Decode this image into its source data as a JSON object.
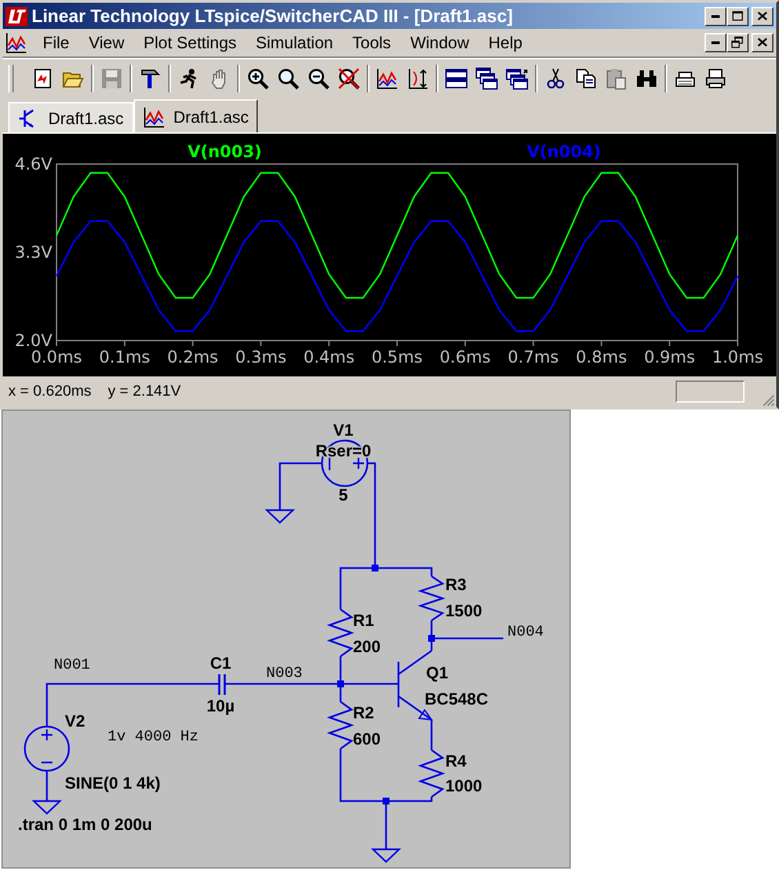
{
  "window": {
    "title": "Linear Technology LTspice/SwitcherCAD III - [Draft1.asc]"
  },
  "menu": [
    {
      "label": "File"
    },
    {
      "label": "View"
    },
    {
      "label": "Plot Settings"
    },
    {
      "label": "Simulation"
    },
    {
      "label": "Tools"
    },
    {
      "label": "Window"
    },
    {
      "label": "Help"
    }
  ],
  "toolbar": [
    [
      {
        "disabled": false
      },
      {
        "disabled": false
      }
    ],
    [
      {
        "disabled": true
      }
    ],
    [
      {
        "disabled": false
      }
    ],
    [
      {
        "disabled": false
      },
      {
        "disabled": true
      }
    ],
    [
      {
        "disabled": false
      },
      {
        "disabled": false
      },
      {
        "disabled": false
      },
      {
        "disabled": false
      }
    ],
    [
      {
        "disabled": false
      },
      {
        "disabled": false
      }
    ],
    [
      {
        "disabled": false
      },
      {
        "disabled": false
      },
      {
        "disabled": false
      }
    ],
    [
      {
        "disabled": false
      },
      {
        "disabled": false
      },
      {
        "disabled": true
      },
      {
        "disabled": false
      }
    ],
    [
      {
        "disabled": false
      },
      {
        "disabled": false
      }
    ]
  ],
  "tabs": [
    {
      "label": "Draft1.asc",
      "kind": "schematic",
      "selected": false
    },
    {
      "label": "Draft1.asc",
      "kind": "plot",
      "selected": true
    }
  ],
  "plot": {
    "chart_data": {
      "type": "line",
      "x": [
        0,
        0.025,
        0.05,
        0.075,
        0.1,
        0.125,
        0.15,
        0.175,
        0.2,
        0.225,
        0.25,
        0.275,
        0.3,
        0.325,
        0.35,
        0.375,
        0.4,
        0.425,
        0.45,
        0.475,
        0.5,
        0.525,
        0.55,
        0.575,
        0.6,
        0.625,
        0.65,
        0.675,
        0.7,
        0.725,
        0.75,
        0.775,
        0.8,
        0.825,
        0.85,
        0.875,
        0.9,
        0.925,
        0.95,
        0.975,
        1.0
      ],
      "series": [
        {
          "name": "V(n003)",
          "color": "#00ff00",
          "values": [
            3.55,
            4.12,
            4.47,
            4.47,
            4.12,
            3.55,
            2.98,
            2.63,
            2.63,
            2.98,
            3.55,
            4.12,
            4.47,
            4.47,
            4.12,
            3.55,
            2.98,
            2.63,
            2.63,
            2.98,
            3.55,
            4.12,
            4.47,
            4.47,
            4.12,
            3.55,
            2.98,
            2.63,
            2.63,
            2.98,
            3.55,
            4.12,
            4.47,
            4.47,
            4.12,
            3.55,
            2.98,
            2.63,
            2.63,
            2.98,
            3.55
          ]
        },
        {
          "name": "V(n004)",
          "color": "#0000ff",
          "values": [
            2.95,
            3.45,
            3.76,
            3.76,
            3.45,
            2.95,
            2.45,
            2.14,
            2.14,
            2.45,
            2.95,
            3.45,
            3.76,
            3.76,
            3.45,
            2.95,
            2.45,
            2.14,
            2.14,
            2.45,
            2.95,
            3.45,
            3.76,
            3.76,
            3.45,
            2.95,
            2.45,
            2.14,
            2.14,
            2.45,
            2.95,
            3.45,
            3.76,
            3.76,
            3.45,
            2.95,
            2.45,
            2.14,
            2.14,
            2.45,
            2.95
          ]
        }
      ],
      "xlim": [
        0,
        1
      ],
      "ylim": [
        2,
        4.6
      ],
      "xticks": [
        {
          "value": 0,
          "label": "0.0ms"
        },
        {
          "value": 0.1,
          "label": "0.1ms"
        },
        {
          "value": 0.2,
          "label": "0.2ms"
        },
        {
          "value": 0.3,
          "label": "0.3ms"
        },
        {
          "value": 0.4,
          "label": "0.4ms"
        },
        {
          "value": 0.5,
          "label": "0.5ms"
        },
        {
          "value": 0.6,
          "label": "0.6ms"
        },
        {
          "value": 0.7,
          "label": "0.7ms"
        },
        {
          "value": 0.8,
          "label": "0.8ms"
        },
        {
          "value": 0.9,
          "label": "0.9ms"
        },
        {
          "value": 1.0,
          "label": "1.0ms"
        }
      ],
      "yticks": [
        {
          "value": 4.6,
          "label": "4.6V"
        },
        {
          "value": 3.3,
          "label": "3.3V"
        },
        {
          "value": 2.0,
          "label": "2.0V"
        }
      ]
    }
  },
  "status_bar": {
    "x_readout": "x = 0.620ms",
    "y_readout": "y = 2.141V"
  },
  "schematic": {
    "labels": [
      {
        "text": "V1",
        "kind": "ref"
      },
      {
        "text": "Rser=0",
        "kind": "value"
      },
      {
        "text": "5",
        "kind": "value"
      },
      {
        "text": "R3",
        "kind": "ref"
      },
      {
        "text": "1500",
        "kind": "value"
      },
      {
        "text": "R1",
        "kind": "ref"
      },
      {
        "text": "200",
        "kind": "value"
      },
      {
        "text": "N004",
        "kind": "net"
      },
      {
        "text": "N001",
        "kind": "net"
      },
      {
        "text": "C1",
        "kind": "ref"
      },
      {
        "text": "N003",
        "kind": "net"
      },
      {
        "text": "Q1",
        "kind": "ref"
      },
      {
        "text": "BC548C",
        "kind": "value"
      },
      {
        "text": "10µ",
        "kind": "value"
      },
      {
        "text": "V2",
        "kind": "ref"
      },
      {
        "text": "1v 4000 Hz",
        "kind": "comment"
      },
      {
        "text": "R2",
        "kind": "ref"
      },
      {
        "text": "600",
        "kind": "value"
      },
      {
        "text": "SINE(0 1 4k)",
        "kind": "value"
      },
      {
        "text": "R4",
        "kind": "ref"
      },
      {
        "text": "1000",
        "kind": "value"
      },
      {
        "text": ".tran 0 1m 0 200u",
        "kind": "directive"
      }
    ]
  }
}
